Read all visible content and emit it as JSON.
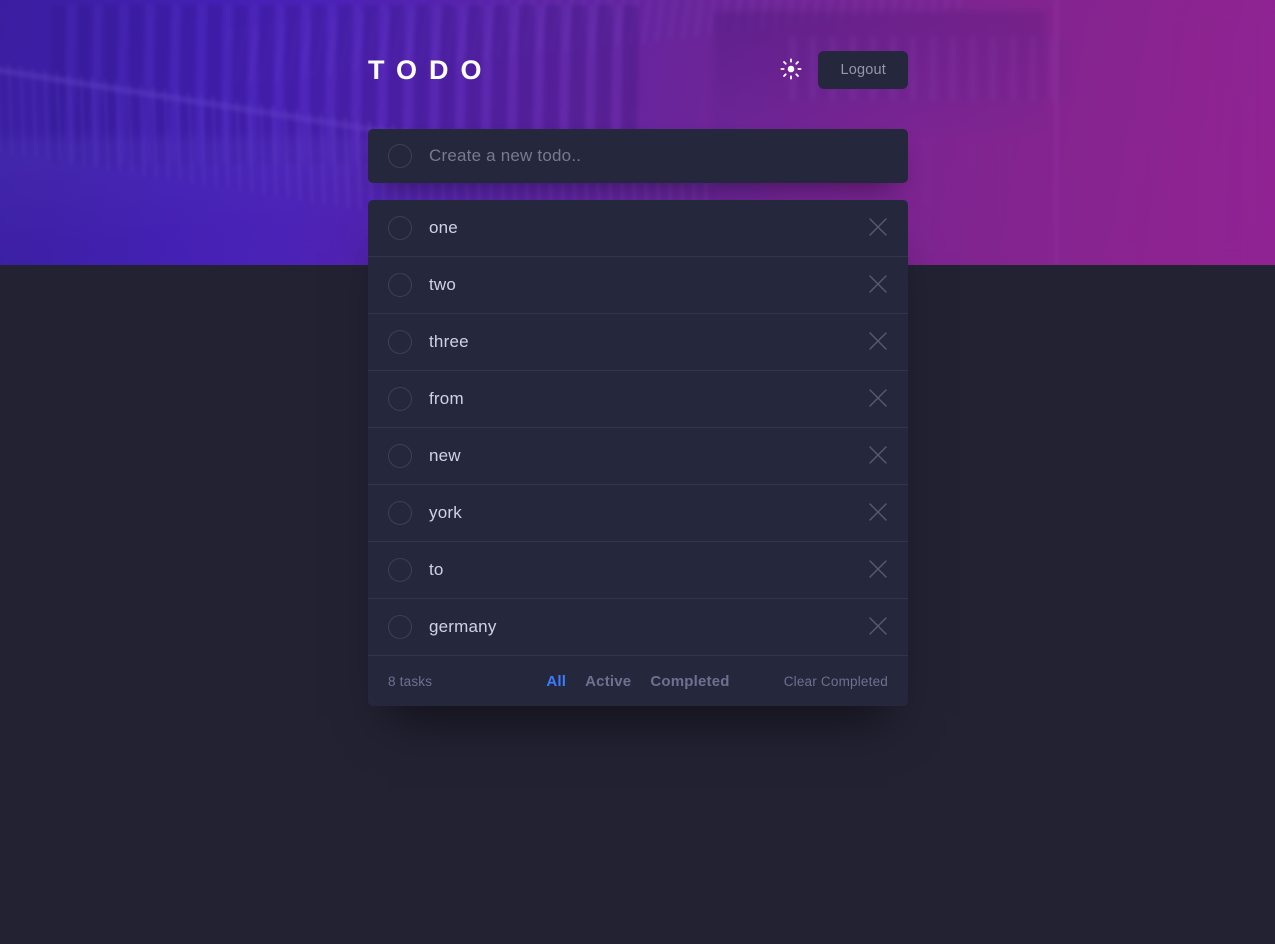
{
  "app": {
    "title": "TODO",
    "background_color": "#232233",
    "card_color": "#25273d",
    "accent_color": "#3a7cfd"
  },
  "header": {
    "logo": "TODO",
    "theme_toggle_icon": "sun-icon",
    "logout_label": "Logout"
  },
  "create": {
    "placeholder": "Create a new todo..",
    "value": "",
    "checkbox_icon": "circle-icon"
  },
  "todos": [
    {
      "label": "one",
      "completed": false
    },
    {
      "label": "two",
      "completed": false
    },
    {
      "label": "three",
      "completed": false
    },
    {
      "label": "from",
      "completed": false
    },
    {
      "label": "new",
      "completed": false
    },
    {
      "label": "york",
      "completed": false
    },
    {
      "label": "to",
      "completed": false
    },
    {
      "label": "germany",
      "completed": false
    }
  ],
  "footer": {
    "task_count": "8 tasks",
    "filters": [
      {
        "label": "All",
        "active": true
      },
      {
        "label": "Active",
        "active": false
      },
      {
        "label": "Completed",
        "active": false
      }
    ],
    "clear_label": "Clear Completed"
  },
  "icons": {
    "delete": "close-icon",
    "checkbox": "circle-icon",
    "theme": "sun-icon"
  }
}
